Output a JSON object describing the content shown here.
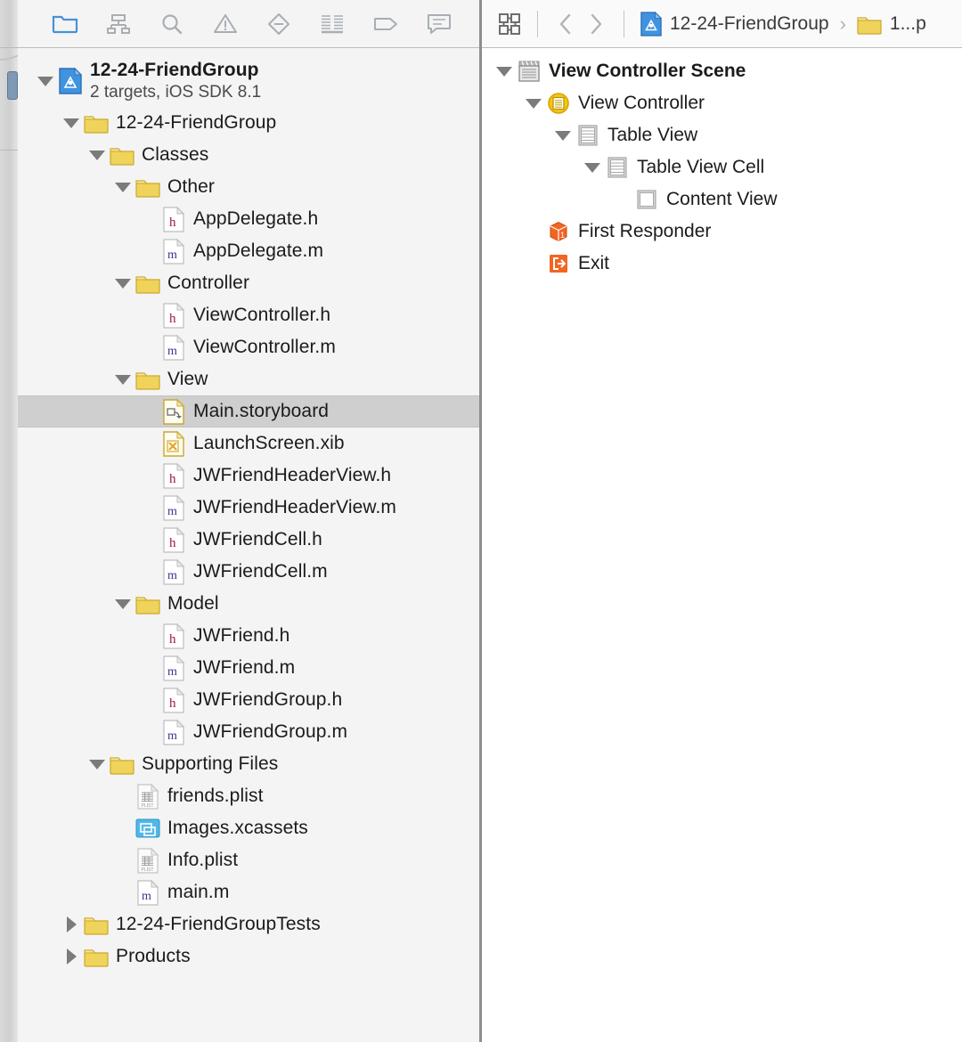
{
  "navigator": {
    "toolbar": [
      {
        "name": "project-navigator-icon",
        "label": "Project navigator",
        "active": true
      },
      {
        "name": "symbol-navigator-icon",
        "label": "Symbol navigator",
        "active": false
      },
      {
        "name": "find-navigator-icon",
        "label": "Find navigator",
        "active": false
      },
      {
        "name": "issue-navigator-icon",
        "label": "Issue navigator",
        "active": false
      },
      {
        "name": "test-navigator-icon",
        "label": "Test navigator",
        "active": false
      },
      {
        "name": "report-navigator-icon",
        "label": "Report navigator",
        "active": false
      },
      {
        "name": "debug-navigator-icon",
        "label": "Debug navigator",
        "active": false
      },
      {
        "name": "log-navigator-icon",
        "label": "Log navigator",
        "active": false
      }
    ],
    "project": {
      "title": "12-24-FriendGroup",
      "subtitle": "2 targets, iOS SDK 8.1",
      "icon": "xcode-project-icon",
      "expanded": true
    },
    "tree": [
      {
        "label": "12-24-FriendGroup",
        "icon": "folder-icon",
        "depth": 1,
        "twisty": "down",
        "selected": false
      },
      {
        "label": "Classes",
        "icon": "folder-icon",
        "depth": 2,
        "twisty": "down",
        "selected": false
      },
      {
        "label": "Other",
        "icon": "folder-icon",
        "depth": 3,
        "twisty": "down",
        "selected": false
      },
      {
        "label": "AppDelegate.h",
        "icon": "header-file-icon",
        "depth": 4,
        "twisty": "none",
        "selected": false
      },
      {
        "label": "AppDelegate.m",
        "icon": "source-file-icon",
        "depth": 4,
        "twisty": "none",
        "selected": false
      },
      {
        "label": "Controller",
        "icon": "folder-icon",
        "depth": 3,
        "twisty": "down",
        "selected": false
      },
      {
        "label": "ViewController.h",
        "icon": "header-file-icon",
        "depth": 4,
        "twisty": "none",
        "selected": false
      },
      {
        "label": "ViewController.m",
        "icon": "source-file-icon",
        "depth": 4,
        "twisty": "none",
        "selected": false
      },
      {
        "label": "View",
        "icon": "folder-icon",
        "depth": 3,
        "twisty": "down",
        "selected": false
      },
      {
        "label": "Main.storyboard",
        "icon": "storyboard-icon",
        "depth": 4,
        "twisty": "none",
        "selected": true
      },
      {
        "label": "LaunchScreen.xib",
        "icon": "xib-icon",
        "depth": 4,
        "twisty": "none",
        "selected": false
      },
      {
        "label": "JWFriendHeaderView.h",
        "icon": "header-file-icon",
        "depth": 4,
        "twisty": "none",
        "selected": false
      },
      {
        "label": "JWFriendHeaderView.m",
        "icon": "source-file-icon",
        "depth": 4,
        "twisty": "none",
        "selected": false
      },
      {
        "label": "JWFriendCell.h",
        "icon": "header-file-icon",
        "depth": 4,
        "twisty": "none",
        "selected": false
      },
      {
        "label": "JWFriendCell.m",
        "icon": "source-file-icon",
        "depth": 4,
        "twisty": "none",
        "selected": false
      },
      {
        "label": "Model",
        "icon": "folder-icon",
        "depth": 3,
        "twisty": "down",
        "selected": false
      },
      {
        "label": "JWFriend.h",
        "icon": "header-file-icon",
        "depth": 4,
        "twisty": "none",
        "selected": false
      },
      {
        "label": "JWFriend.m",
        "icon": "source-file-icon",
        "depth": 4,
        "twisty": "none",
        "selected": false
      },
      {
        "label": "JWFriendGroup.h",
        "icon": "header-file-icon",
        "depth": 4,
        "twisty": "none",
        "selected": false
      },
      {
        "label": "JWFriendGroup.m",
        "icon": "source-file-icon",
        "depth": 4,
        "twisty": "none",
        "selected": false
      },
      {
        "label": "Supporting Files",
        "icon": "folder-icon",
        "depth": 2,
        "twisty": "down",
        "selected": false
      },
      {
        "label": "friends.plist",
        "icon": "plist-file-icon",
        "depth": 3,
        "twisty": "none",
        "selected": false
      },
      {
        "label": "Images.xcassets",
        "icon": "xcassets-icon",
        "depth": 3,
        "twisty": "none",
        "selected": false
      },
      {
        "label": "Info.plist",
        "icon": "plist-file-icon",
        "depth": 3,
        "twisty": "none",
        "selected": false
      },
      {
        "label": "main.m",
        "icon": "source-file-icon",
        "depth": 3,
        "twisty": "none",
        "selected": false
      },
      {
        "label": "12-24-FriendGroupTests",
        "icon": "folder-icon",
        "depth": 1,
        "twisty": "right",
        "selected": false
      },
      {
        "label": "Products",
        "icon": "folder-icon",
        "depth": 1,
        "twisty": "right",
        "selected": false
      }
    ]
  },
  "outline": {
    "breadcrumb": {
      "grid_icon": "related-items-icon",
      "back_icon": "chevron-left-icon",
      "forward_icon": "chevron-right-icon",
      "items": [
        {
          "label": "12-24-FriendGroup",
          "icon": "xcode-project-icon"
        },
        {
          "label": "1...p",
          "icon": "folder-icon"
        }
      ],
      "separator": "›"
    },
    "tree": [
      {
        "label": "View Controller Scene",
        "icon": "scene-icon",
        "depth": 0,
        "twisty": "down",
        "bold": true
      },
      {
        "label": "View Controller",
        "icon": "view-controller-icon",
        "depth": 1,
        "twisty": "down",
        "bold": false
      },
      {
        "label": "Table View",
        "icon": "table-view-icon",
        "depth": 2,
        "twisty": "down",
        "bold": false
      },
      {
        "label": "Table View Cell",
        "icon": "table-view-cell-icon",
        "depth": 3,
        "twisty": "down",
        "bold": false
      },
      {
        "label": "Content View",
        "icon": "content-view-icon",
        "depth": 4,
        "twisty": "none",
        "bold": false
      },
      {
        "label": "First Responder",
        "icon": "first-responder-icon",
        "depth": 1,
        "twisty": "none",
        "bold": false
      },
      {
        "label": "Exit",
        "icon": "exit-icon",
        "depth": 1,
        "twisty": "none",
        "bold": false
      }
    ]
  },
  "colors": {
    "accent": "#4a90d9",
    "folder": "#f0d35a",
    "panel_bg": "#f4f4f4",
    "selection": "#cfcfcf",
    "orange": "#f26522",
    "header_letter": "#a01a3c",
    "source_letter": "#4b2d8f"
  }
}
